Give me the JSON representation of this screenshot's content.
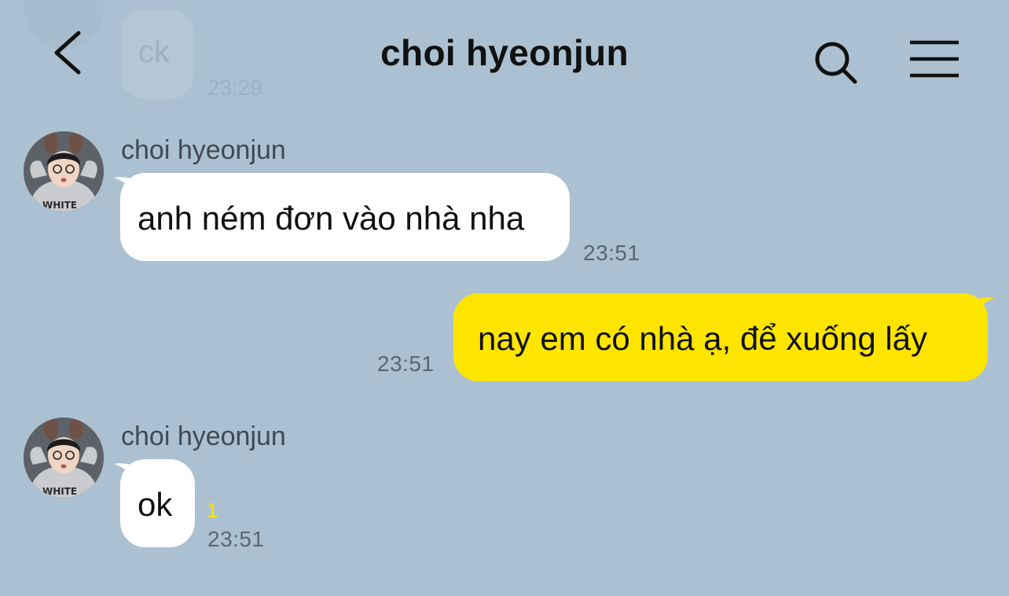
{
  "header": {
    "title": "choi hyeonjun"
  },
  "previous_message": {
    "text": "ck",
    "time": "23:29"
  },
  "messages": [
    {
      "sender": "choi hyeonjun",
      "text": "anh ném đơn vào nhà nha",
      "time": "23:51",
      "direction": "incoming"
    },
    {
      "text": "nay em có nhà ạ, để xuống lấy",
      "time": "23:51",
      "direction": "outgoing"
    },
    {
      "sender": "choi hyeonjun",
      "text": "ok",
      "time": "23:51",
      "unread": "1",
      "direction": "incoming"
    }
  ],
  "colors": {
    "background": "#abc1d1",
    "incoming_bubble": "#ffffff",
    "outgoing_bubble": "#fee500",
    "unread_count": "#fee500"
  },
  "icons": {
    "back": "chevron-left-icon",
    "search": "search-icon",
    "menu": "hamburger-menu-icon"
  }
}
